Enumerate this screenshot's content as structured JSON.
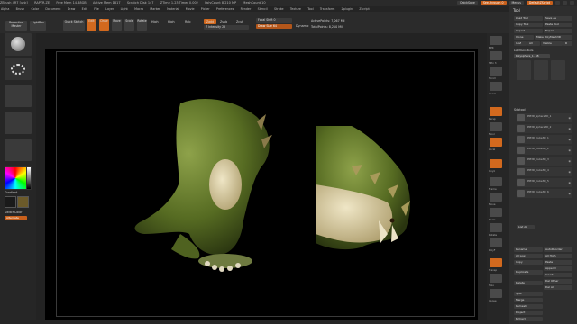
{
  "titlebar": {
    "items": [
      "ZBrush 4R7 [unk]",
      "RAPTR.ZE",
      "Free Mem 14.88GB",
      "Active Mem 1817",
      "Scratch Disk 147",
      "ZTime 1.23 Timer 0.002",
      "PolyCount 8.210 MP",
      "MeshCount 10"
    ],
    "quicksave": "QuickSave",
    "see_through": "See-through 0",
    "menus": "Menus",
    "default_script": "DefaultZScript"
  },
  "menubar": {
    "items": [
      "Alpha",
      "Brush",
      "Color",
      "Document",
      "Draw",
      "Edit",
      "File",
      "Layer",
      "Light",
      "Macro",
      "Marker",
      "Material",
      "Movie",
      "Picker",
      "Preferences",
      "Render",
      "Stencil",
      "Stroke",
      "Texture",
      "Tool",
      "Transform",
      "Zplugin",
      "Zscript"
    ]
  },
  "toolbar": {
    "projection_master": "Projection Master",
    "lightbox": "LightBox",
    "quick_sketch": "Quick Sketch",
    "edit": "Edit",
    "draw": "Draw",
    "move": "Move",
    "scale": "Scale",
    "rotate": "Rotate",
    "high": "High",
    "high_btn": "High",
    "rgb": "Rgb",
    "zadd": "Zadd",
    "zsub": "Zsub",
    "zcut": "Zcut",
    "z_intensity": "Z Intensity 25",
    "focal_shift": "Focal Shift 0",
    "draw_size": "Draw Size 64",
    "dynamic": "Dynamic",
    "active_points": "ActivePoints: 7,067 Mil",
    "total_points": "TotalPoints: 8,210 Mil"
  },
  "leftshelf": {
    "gradient_label": "Gradient",
    "switch_color": "SwitchColor",
    "alternate": "Alternate",
    "colors": {
      "main": "#1a1a1a",
      "secondary": "#6b5a2a",
      "accent": "#d2691e"
    }
  },
  "rightshelf": {
    "labels": [
      "BPR",
      "SPix 3",
      "Scroll",
      "Zoom",
      "Actual",
      "AAHalf",
      "Persp",
      "Floor",
      "Local",
      "L.Sym",
      "Gxyz",
      "Frame",
      "Move",
      "Scale",
      "Rotate",
      "PolyF",
      "Transp",
      "Ghost",
      "Solo",
      "Xpose"
    ]
  },
  "toolpanel": {
    "title": "Tool",
    "load_tool": "Load Tool",
    "save_as": "Save As",
    "copy_tool": "Copy Tool",
    "paste_tool": "Paste Tool",
    "import": "Import",
    "export": "Export",
    "clone": "Clone",
    "make_polymesh": "Make PolyMesh3D",
    "goz": "GoZ",
    "all": "All",
    "visible": "Visible",
    "r_btn": "R",
    "lightbox_tools": "Lightbox›Tools",
    "current_tool": "Polysphere_1. 48",
    "subtool_header": "Subtool",
    "subtools": [
      "PM3D_Sphere3D_1",
      "PM3D_Sphere3D_2",
      "PM3D_Cube3D_1",
      "PM3D_Cube3D_2",
      "PM3D_Cube3D_3",
      "PM3D_Cube3D_4",
      "PM3D_Cube3D_5",
      "PM3D_Cube3D_6"
    ],
    "list_all": "List All",
    "rename": "Rename",
    "autoreorder": "AutoReorder",
    "all_low": "All Low",
    "all_high": "All High",
    "copy": "Copy",
    "paste": "Paste",
    "duplicate": "Duplicate",
    "append": "Append",
    "insert": "Insert",
    "delete": "Delete",
    "del_other": "Del Other",
    "del_all": "Del All",
    "split": "Split",
    "merge": "Merge",
    "remesh": "Remesh",
    "project": "Project",
    "extract": "Extract"
  },
  "canvas": {
    "background": "#000000"
  }
}
